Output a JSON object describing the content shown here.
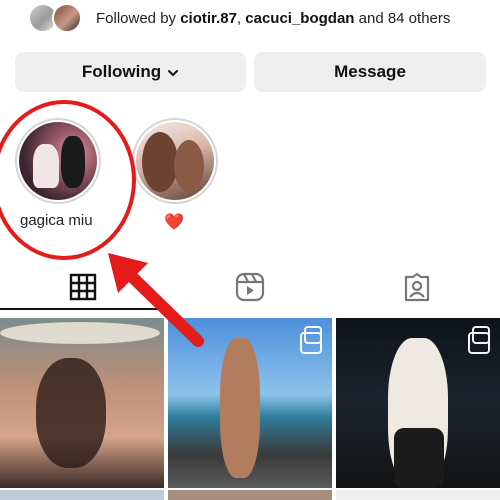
{
  "followed_by": {
    "prefix": "Followed by",
    "user1": "ciotir.87",
    "separator": ",",
    "user2": "cacuci_bogdan",
    "suffix": "and 84 others"
  },
  "buttons": {
    "following_label": "Following",
    "message_label": "Message",
    "following_chevron": "chevron-down-icon"
  },
  "highlights": [
    {
      "label": "gagica miu"
    },
    {
      "label": "❤️"
    }
  ],
  "tabs": [
    {
      "name": "posts",
      "icon": "grid-icon",
      "selected": true
    },
    {
      "name": "reels",
      "icon": "reels-icon",
      "selected": false
    },
    {
      "name": "tagged",
      "icon": "tagged-icon",
      "selected": false
    }
  ],
  "colors": {
    "button_bg": "#efefef",
    "annotation_red": "#e51b1b",
    "heart": "#ed4956"
  }
}
